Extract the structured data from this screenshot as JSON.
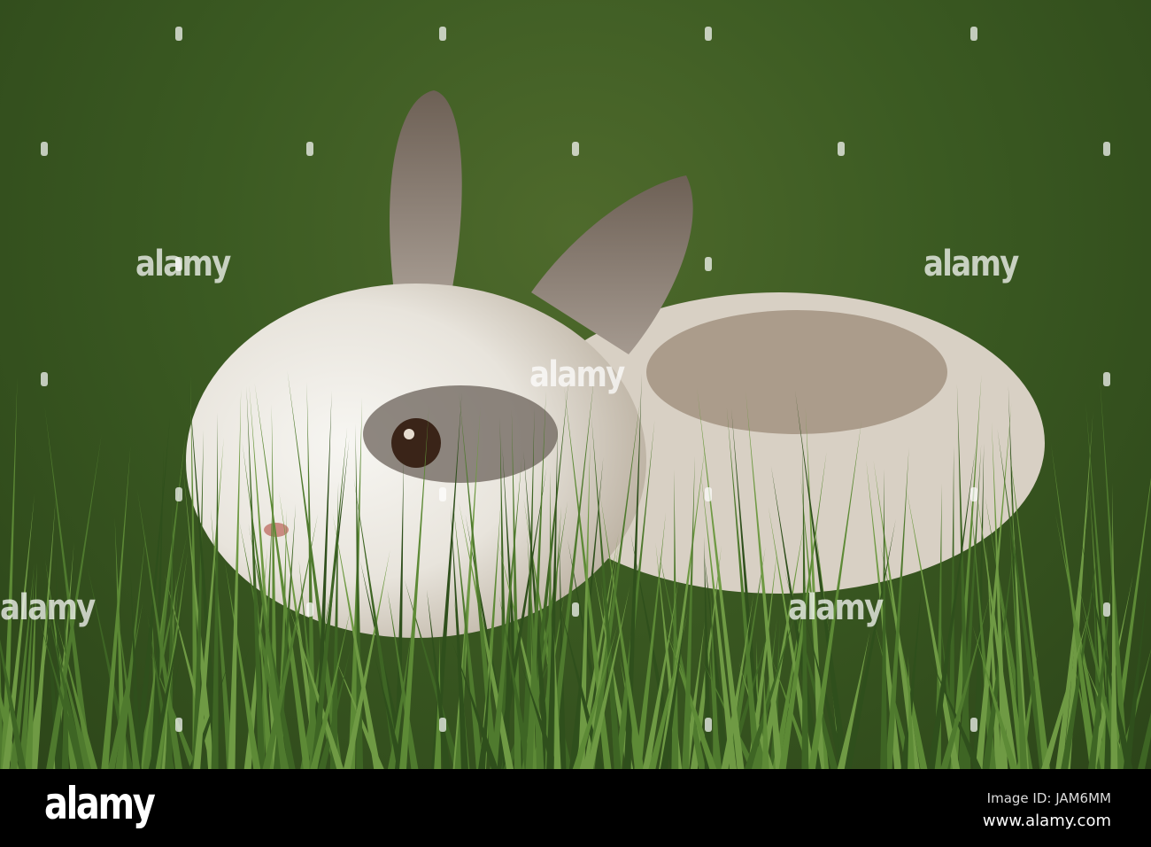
{
  "watermark": "alamy",
  "footer": {
    "logo": "alamy",
    "image_id": "Image ID: JAM6MM",
    "website": "www.alamy.com"
  }
}
